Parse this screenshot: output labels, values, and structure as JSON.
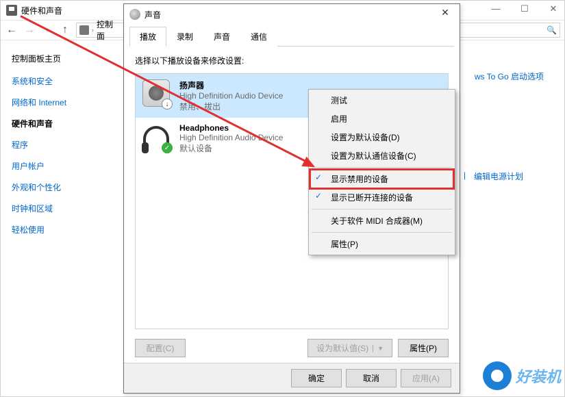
{
  "outer": {
    "title": "硬件和声音",
    "breadcrumb": "控制面"
  },
  "sidebar": {
    "heading": "控制面板主页",
    "items": [
      "系统和安全",
      "网络和 Internet",
      "硬件和声音",
      "程序",
      "用户帐户",
      "外观和个性化",
      "时钟和区域",
      "轻松使用"
    ],
    "currentIndex": 2
  },
  "mainLinks": {
    "topRight": "ws To Go 启动选项",
    "right": "编辑电源计划"
  },
  "dialog": {
    "title": "声音",
    "tabs": [
      "播放",
      "录制",
      "声音",
      "通信"
    ],
    "activeTab": 0,
    "instruction": "选择以下播放设备来修改设置:",
    "devices": [
      {
        "name": "扬声器",
        "desc": "High Definition Audio Device",
        "status": "禁用、拔出",
        "selected": true,
        "iconType": "speaker",
        "badge": "down"
      },
      {
        "name": "Headphones",
        "desc": "High Definition Audio Device",
        "status": "默认设备",
        "selected": false,
        "iconType": "headphones",
        "badge": "ok"
      }
    ],
    "btnConfigure": "配置(C)",
    "btnDefault": "设为默认值(S)",
    "btnProperties": "属性(P)",
    "btnOK": "确定",
    "btnCancel": "取消",
    "btnApply": "应用(A)"
  },
  "contextMenu": {
    "items": [
      {
        "label": "测试"
      },
      {
        "label": "启用"
      },
      {
        "label": "设置为默认设备(D)"
      },
      {
        "label": "设置为默认通信设备(C)"
      },
      {
        "sep": true
      },
      {
        "label": "显示禁用的设备",
        "checked": true,
        "highlight": true
      },
      {
        "label": "显示已断开连接的设备",
        "checked": true
      },
      {
        "sep": true
      },
      {
        "label": "关于软件 MIDI 合成器(M)"
      },
      {
        "sep": true
      },
      {
        "label": "属性(P)"
      }
    ]
  },
  "watermark": "好装机"
}
